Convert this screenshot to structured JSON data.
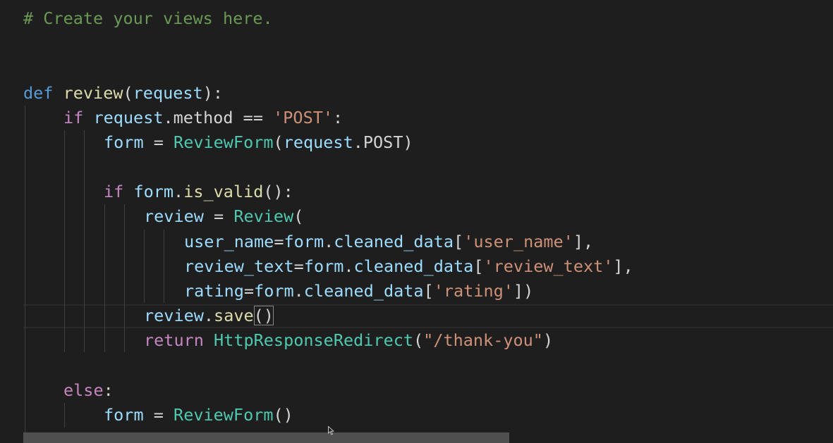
{
  "editor": {
    "language": "python",
    "lines": [
      {
        "tokens": [
          {
            "t": "# Create your views here.",
            "c": "comment"
          }
        ]
      },
      {
        "tokens": [
          {
            "t": "def",
            "c": "kw-def"
          },
          {
            "t": " ",
            "c": "plain"
          },
          {
            "t": "review",
            "c": "fn"
          },
          {
            "t": "(",
            "c": "plain"
          },
          {
            "t": "request",
            "c": "var"
          },
          {
            "t": "):",
            "c": "plain"
          }
        ]
      },
      {
        "tokens": [
          {
            "t": "if",
            "c": "kw"
          },
          {
            "t": " ",
            "c": "plain"
          },
          {
            "t": "request",
            "c": "var"
          },
          {
            "t": ".method == ",
            "c": "plain"
          },
          {
            "t": "'POST'",
            "c": "str"
          },
          {
            "t": ":",
            "c": "plain"
          }
        ]
      },
      {
        "tokens": [
          {
            "t": "form",
            "c": "var"
          },
          {
            "t": " = ",
            "c": "plain"
          },
          {
            "t": "ReviewForm",
            "c": "cls"
          },
          {
            "t": "(",
            "c": "plain"
          },
          {
            "t": "request",
            "c": "var"
          },
          {
            "t": ".POST)",
            "c": "plain"
          }
        ]
      },
      {
        "tokens": [
          {
            "t": "if",
            "c": "kw"
          },
          {
            "t": " ",
            "c": "plain"
          },
          {
            "t": "form",
            "c": "var"
          },
          {
            "t": ".",
            "c": "plain"
          },
          {
            "t": "is_valid",
            "c": "fn"
          },
          {
            "t": "():",
            "c": "plain"
          }
        ]
      },
      {
        "tokens": [
          {
            "t": "review",
            "c": "var"
          },
          {
            "t": " = ",
            "c": "plain"
          },
          {
            "t": "Review",
            "c": "cls"
          },
          {
            "t": "(",
            "c": "plain"
          }
        ]
      },
      {
        "tokens": [
          {
            "t": "user_name",
            "c": "var"
          },
          {
            "t": "=",
            "c": "plain"
          },
          {
            "t": "form",
            "c": "var"
          },
          {
            "t": ".",
            "c": "plain"
          },
          {
            "t": "cleaned_data",
            "c": "var"
          },
          {
            "t": "[",
            "c": "plain"
          },
          {
            "t": "'user_name'",
            "c": "str"
          },
          {
            "t": "],",
            "c": "plain"
          }
        ]
      },
      {
        "tokens": [
          {
            "t": "review_text",
            "c": "var"
          },
          {
            "t": "=",
            "c": "plain"
          },
          {
            "t": "form",
            "c": "var"
          },
          {
            "t": ".",
            "c": "plain"
          },
          {
            "t": "cleaned_data",
            "c": "var"
          },
          {
            "t": "[",
            "c": "plain"
          },
          {
            "t": "'review_text'",
            "c": "str"
          },
          {
            "t": "],",
            "c": "plain"
          }
        ]
      },
      {
        "tokens": [
          {
            "t": "rating",
            "c": "var"
          },
          {
            "t": "=",
            "c": "plain"
          },
          {
            "t": "form",
            "c": "var"
          },
          {
            "t": ".",
            "c": "plain"
          },
          {
            "t": "cleaned_data",
            "c": "var"
          },
          {
            "t": "[",
            "c": "plain"
          },
          {
            "t": "'rating'",
            "c": "str"
          },
          {
            "t": "])",
            "c": "plain"
          }
        ]
      },
      {
        "tokens": [
          {
            "t": "review",
            "c": "var"
          },
          {
            "t": ".",
            "c": "plain"
          },
          {
            "t": "save",
            "c": "fn"
          },
          {
            "t": "()",
            "c": "plain",
            "m": 1
          }
        ]
      },
      {
        "tokens": [
          {
            "t": "return",
            "c": "kw"
          },
          {
            "t": " ",
            "c": "plain"
          },
          {
            "t": "HttpResponseRedirect",
            "c": "cls"
          },
          {
            "t": "(",
            "c": "plain"
          },
          {
            "t": "\"/thank-you\"",
            "c": "str"
          },
          {
            "t": ")",
            "c": "plain"
          }
        ]
      },
      {
        "tokens": [
          {
            "t": "else",
            "c": "kw"
          },
          {
            "t": ":",
            "c": "plain"
          }
        ]
      },
      {
        "tokens": [
          {
            "t": "form",
            "c": "var"
          },
          {
            "t": " = ",
            "c": "plain"
          },
          {
            "t": "ReviewForm",
            "c": "cls"
          },
          {
            "t": "()",
            "c": "plain"
          }
        ]
      }
    ]
  },
  "colors": {
    "background": "#1e1e1e",
    "comment": "#6a9955",
    "keyword_def": "#569cd6",
    "keyword_control": "#c586c0",
    "function": "#dcdcaa",
    "variable": "#9cdcfe",
    "class": "#4ec9b0",
    "string": "#ce9178",
    "plain": "#d4d4d4"
  },
  "icons": {
    "cursor": "mouse-pointer-icon"
  }
}
